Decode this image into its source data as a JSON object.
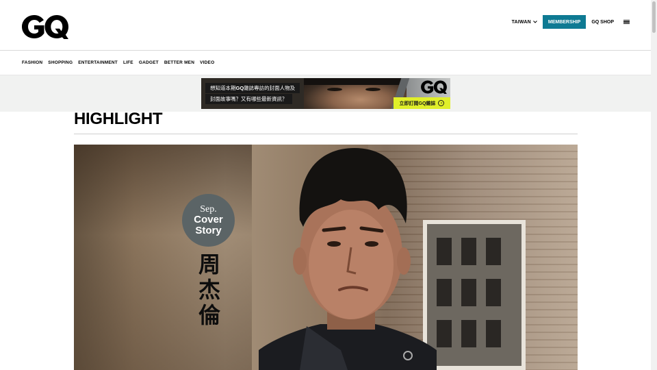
{
  "header": {
    "logo": "GQ",
    "region": "TAIWAN",
    "membership": "MEMBERSHIP",
    "shop": "GQ SHOP"
  },
  "nav": {
    "items": [
      "FASHION",
      "SHOPPING",
      "ENTERTAINMENT",
      "LIFE",
      "GADGET",
      "BETTER MEN",
      "VIDEO"
    ]
  },
  "banner": {
    "line1_pre": "想知道本期",
    "line1_brand": "GQ",
    "line1_post": "雜誌專訪的封面人物及",
    "line2": "封面故事嗎？又有哪些最新資訊？",
    "logo": "GQ",
    "cta": "立即訂閱GQ雜誌"
  },
  "highlight": {
    "title": "HIGHLIGHT"
  },
  "hero": {
    "badge_month": "Sep.",
    "badge_line1": "Cover",
    "badge_line2": "Story",
    "name_chars": [
      "周",
      "杰",
      "倫"
    ]
  },
  "colors": {
    "membership_bg": "#0e7a93",
    "cta_bg": "#e0ef2a",
    "badge_bg": "#5b6466"
  }
}
